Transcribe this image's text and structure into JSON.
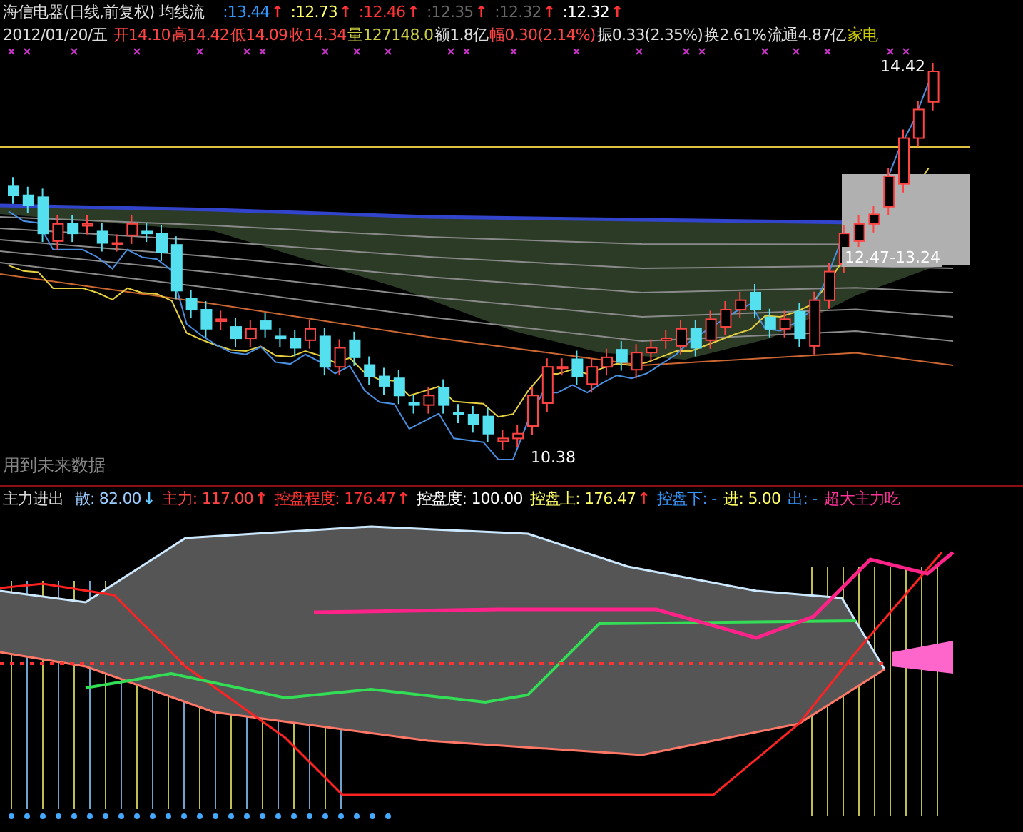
{
  "top_panel": {
    "title": "海信电器(日线,前复权)",
    "indicator": "均线流",
    "ma_values": [
      {
        "text": ":13.44",
        "color": "#3399ff",
        "arrow": {
          "text": "↑",
          "color": "#ff3333"
        }
      },
      {
        "text": ":12.73",
        "color": "#ffff66",
        "arrow": {
          "text": "↑",
          "color": "#ff3333"
        }
      },
      {
        "text": ":12.46",
        "color": "#ff3333",
        "arrow": {
          "text": "↑",
          "color": "#ff3333"
        }
      },
      {
        "text": ":12.35",
        "color": "#666666",
        "arrow": {
          "text": "↑",
          "color": "#ff3333"
        }
      },
      {
        "text": ":12.32",
        "color": "#666666",
        "arrow": {
          "text": "↑",
          "color": "#ff3333"
        }
      },
      {
        "text": ":12.32",
        "color": "#ffffff",
        "arrow": {
          "text": "↑",
          "color": "#ff3333"
        }
      }
    ],
    "date": "2012/01/20/五",
    "quote": [
      {
        "text": "开14.10",
        "color": "#ff4444"
      },
      {
        "text": "高14.42",
        "color": "#ff4444"
      },
      {
        "text": "低14.09",
        "color": "#ff4444"
      },
      {
        "text": "收14.34",
        "color": "#ff4444"
      },
      {
        "text": "量127148.0",
        "color": "#cccc44"
      },
      {
        "text": "额1.8亿",
        "color": "#dddddd"
      },
      {
        "text": "幅0.30(2.14%)",
        "color": "#ff4444"
      },
      {
        "text": "振0.33(2.35%)",
        "color": "#dddddd"
      },
      {
        "text": "换2.61%",
        "color": "#dddddd"
      },
      {
        "text": "流通4.87亿",
        "color": "#dddddd"
      },
      {
        "text": "家电",
        "color": "#cccc00"
      }
    ],
    "high_label": "14.42",
    "low_label": "10.38",
    "range_label": "12.47-13.24",
    "note": "用到未来数据"
  },
  "bottom_panel": {
    "title": "主力进出",
    "values": [
      {
        "text": "散: 82.00",
        "color": "#99ccff",
        "arrow": {
          "text": "↓",
          "color": "#66ccff"
        }
      },
      {
        "text": "主力: 117.00",
        "color": "#ff4444",
        "arrow": {
          "text": "↑",
          "color": "#ff3333"
        }
      },
      {
        "text": "控盘程度: 176.47",
        "color": "#ff3333",
        "arrow": {
          "text": "↑",
          "color": "#ff3333"
        }
      },
      {
        "text": "控盘度: 100.00",
        "color": "#ffffff"
      },
      {
        "text": "控盘上: 176.47",
        "color": "#ffff66",
        "arrow": {
          "text": "↑",
          "color": "#ff3333"
        }
      },
      {
        "text": "控盘下: -",
        "color": "#3399ff"
      },
      {
        "text": "进: 5.00",
        "color": "#ffff66"
      },
      {
        "text": "出: -",
        "color": "#3399ff"
      },
      {
        "text": "超大主力吃",
        "color": "#ff3399"
      }
    ]
  }
}
